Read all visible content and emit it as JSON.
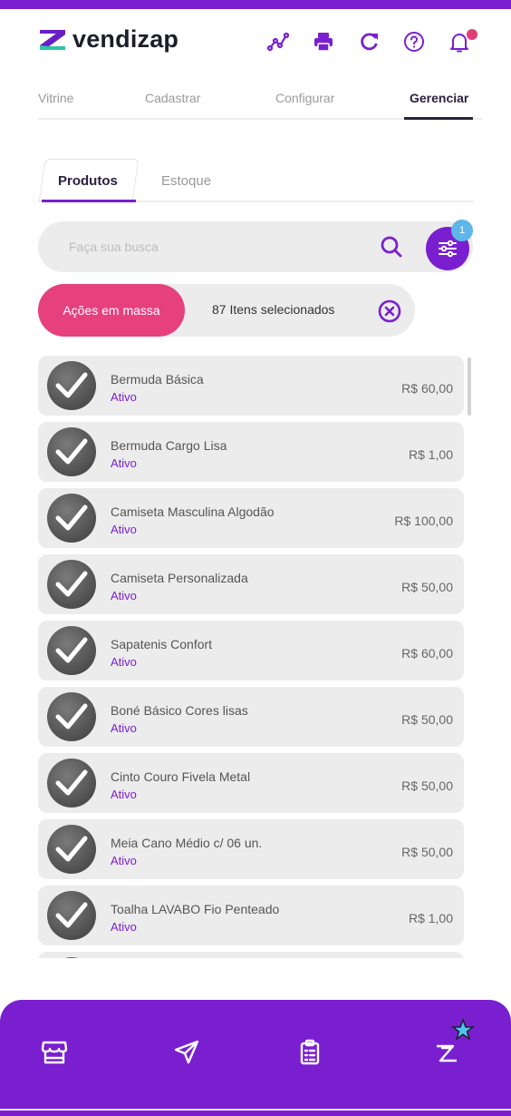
{
  "app": {
    "name": "vendizap"
  },
  "colors": {
    "brand": "#7a1fcf",
    "accent": "#e6417c",
    "status_active": "#7a1fcf",
    "badge": "#5fb6e8"
  },
  "header": {
    "icons": [
      "analytics-icon",
      "printer-icon",
      "refresh-icon",
      "help-icon",
      "notification-bell-icon"
    ]
  },
  "main_tabs": [
    {
      "label": "Vitrine",
      "active": false
    },
    {
      "label": "Cadastrar",
      "active": false
    },
    {
      "label": "Configurar",
      "active": false
    },
    {
      "label": "Gerenciar",
      "active": true
    }
  ],
  "sub_tabs": [
    {
      "label": "Produtos",
      "active": true
    },
    {
      "label": "Estoque",
      "active": false
    }
  ],
  "search": {
    "placeholder": "Faça sua busca",
    "value": "",
    "filter_badge": "1"
  },
  "bulk": {
    "button_label": "Ações em massa",
    "selected_text": "87 Itens selecionados"
  },
  "products": [
    {
      "name": "Bermuda Básica",
      "status": "Ativo",
      "price": "R$ 60,00",
      "selected": true
    },
    {
      "name": "Bermuda Cargo Lisa",
      "status": "Ativo",
      "price": "R$ 1,00",
      "selected": true
    },
    {
      "name": "Camiseta Masculina Algodão",
      "status": "Ativo",
      "price": "R$ 100,00",
      "selected": true
    },
    {
      "name": "Camiseta Personalizada",
      "status": "Ativo",
      "price": "R$ 50,00",
      "selected": true
    },
    {
      "name": "Sapatenis Confort",
      "status": "Ativo",
      "price": "R$ 60,00",
      "selected": true
    },
    {
      "name": "Boné Básico Cores lisas",
      "status": "Ativo",
      "price": "R$ 50,00",
      "selected": true
    },
    {
      "name": "Cinto Couro Fivela Metal",
      "status": "Ativo",
      "price": "R$ 50,00",
      "selected": true
    },
    {
      "name": "Meia Cano Médio c/ 06 un.",
      "status": "Ativo",
      "price": "R$ 50,00",
      "selected": true
    },
    {
      "name": "Toalha LAVABO Fio Penteado",
      "status": "Ativo",
      "price": "R$ 1,00",
      "selected": true
    }
  ],
  "bottom_nav": [
    {
      "icon": "store-icon"
    },
    {
      "icon": "send-icon"
    },
    {
      "icon": "clipboard-list-icon"
    },
    {
      "icon": "vendizap-pro-icon"
    }
  ]
}
